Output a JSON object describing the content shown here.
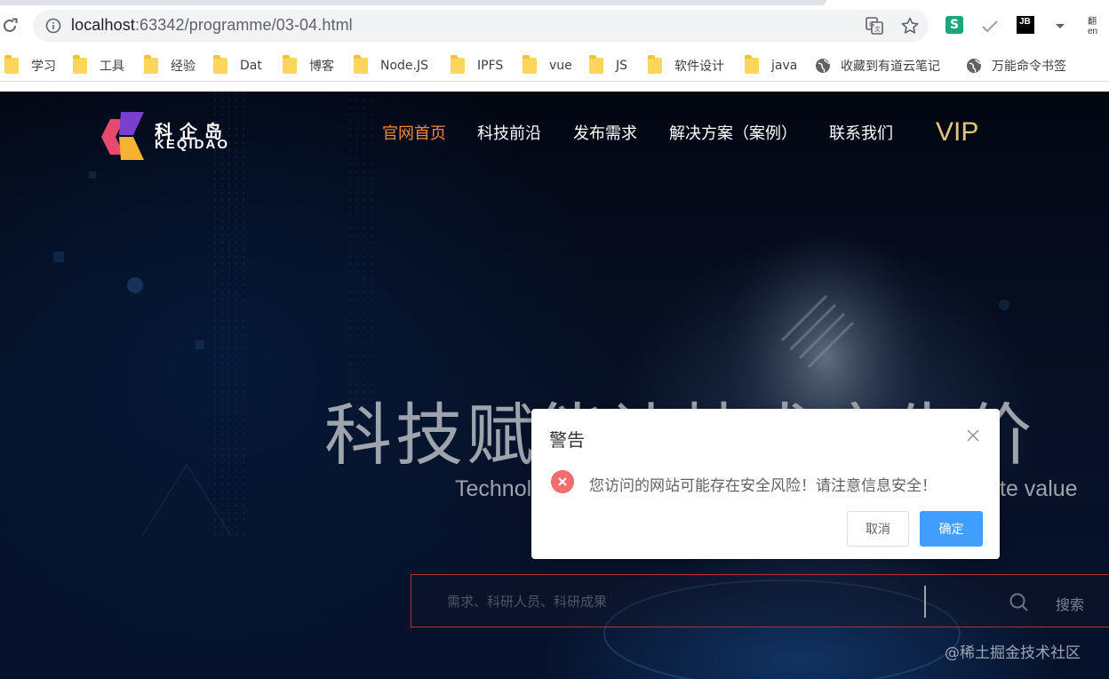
{
  "browser": {
    "url_host": "localhost",
    "url_path": ":63342/programme/03-04.html",
    "bookmarks": [
      {
        "label": "学习",
        "type": "folder"
      },
      {
        "label": "工具",
        "type": "folder"
      },
      {
        "label": "经验",
        "type": "folder"
      },
      {
        "label": "Dat",
        "type": "folder"
      },
      {
        "label": "博客",
        "type": "folder"
      },
      {
        "label": "Node.JS",
        "type": "folder"
      },
      {
        "label": "IPFS",
        "type": "folder"
      },
      {
        "label": "vue",
        "type": "folder"
      },
      {
        "label": "JS",
        "type": "folder"
      },
      {
        "label": "软件设计",
        "type": "folder"
      },
      {
        "label": "java",
        "type": "folder"
      },
      {
        "label": "收藏到有道云笔记",
        "type": "page"
      },
      {
        "label": "万能命令书签",
        "type": "page"
      }
    ],
    "extensions": {
      "s_label": "S",
      "jb_label": "JB",
      "youdao_label": "翻\nen"
    }
  },
  "site": {
    "logo_cn": "科企岛",
    "logo_en": "KEQIDAO",
    "nav": [
      {
        "label": "官网首页",
        "active": true
      },
      {
        "label": "科技前沿",
        "active": false
      },
      {
        "label": "发布需求",
        "active": false
      },
      {
        "label": "解决方案（案例）",
        "active": false
      },
      {
        "label": "联系我们",
        "active": false
      }
    ],
    "vip": "VIP",
    "hero_title": "科技赋能让技术产生价",
    "hero_sub_left": "Technol",
    "hero_sub_right": "te value",
    "search_placeholder": "需求、科研人员、科研成果",
    "search_label": "搜索"
  },
  "watermark": "@稀土掘金技术社区",
  "modal": {
    "title": "警告",
    "message": "您访问的网站可能存在安全风险！请注意信息安全！",
    "cancel_label": "取消",
    "confirm_label": "确定"
  },
  "colors": {
    "nav_active": "#f0893c",
    "vip": "#e3c67d",
    "confirm_button": "#409eff",
    "error_icon": "#f56c6c",
    "search_border": "#b2303a"
  }
}
